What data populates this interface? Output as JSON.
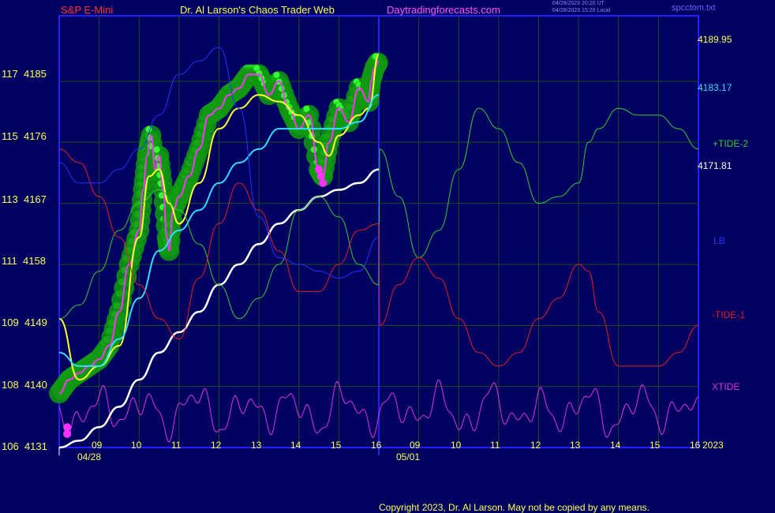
{
  "header": {
    "left_title": "S&P E-Mini",
    "center_title": "Dr. Al Larson's Chaos Trader Web",
    "site": "Daytradingforecasts.com",
    "timestamp_utc": "04/28/2023 20:20 UT",
    "timestamp_local": "04/28/2023 15:20 Local",
    "file": "spcctom.txt"
  },
  "footer": {
    "copyright": "Copyright 2023, Dr. Al Larson. May not be copied by any means."
  },
  "colors": {
    "background": "#000060",
    "frame": "#2020ff",
    "grid": "#1f4a1f",
    "price": "#ff33ff",
    "fast_ma": "#ffff33",
    "mid_ma": "#33ddff",
    "slow_ma": "#ffffff",
    "tide2": "#33cc33",
    "tide1": "#dd2222",
    "lb": "#2233ff",
    "xtide": "#dd33dd",
    "highlight": "#119911",
    "highlight_dot": "#33ff33",
    "low_dot": "#ff33ff"
  },
  "chart_data": {
    "type": "line",
    "title": "S&P E-Mini",
    "y_axis_labels": [
      {
        "left": "117",
        "right": "4185"
      },
      {
        "left": "115",
        "right": "4176"
      },
      {
        "left": "113",
        "right": "4167"
      },
      {
        "left": "111",
        "right": "4158"
      },
      {
        "left": "109",
        "right": "4149"
      },
      {
        "left": "108",
        "right": "4140"
      },
      {
        "left": "106",
        "right": "4131"
      }
    ],
    "ylim": [
      4131,
      4185
    ],
    "x_hour_labels": [
      "09",
      "10",
      "11",
      "12",
      "13",
      "14",
      "15",
      "16",
      "09",
      "10",
      "11",
      "12",
      "13",
      "14",
      "15",
      "16"
    ],
    "x_date_labels": [
      "04/28",
      "05/01"
    ],
    "x_end_label": "2023",
    "x_unit": "hours",
    "xlim": [
      8,
      24
    ],
    "now_x": 16,
    "right_labels": {
      "last_price": "4189.95",
      "mid_ma_value": "4183.17",
      "slow_ma_value": "4171.81",
      "tide2": "+TIDE-2",
      "lb": "LB",
      "tide1": "-TIDE-1",
      "xtide": "XTIDE"
    },
    "series": [
      {
        "name": "price",
        "x": [
          8,
          8.25,
          8.5,
          8.75,
          9,
          9.25,
          9.5,
          9.75,
          10,
          10.1,
          10.2,
          10.3,
          10.4,
          10.5,
          10.6,
          10.7,
          10.75,
          10.85,
          11,
          11.25,
          11.5,
          11.75,
          12,
          12.25,
          12.5,
          12.75,
          13,
          13.25,
          13.5,
          13.75,
          14,
          14.25,
          14.5,
          14.6,
          14.75,
          15,
          15.25,
          15.5,
          15.75,
          15.8,
          15.9,
          16
        ],
        "y": [
          4139,
          4141,
          4142,
          4143,
          4144,
          4146,
          4151,
          4158,
          4163,
          4169,
          4174,
          4177,
          4172,
          4174,
          4169,
          4162,
          4160,
          4166,
          4168,
          4171,
          4175,
          4180,
          4181,
          4183,
          4184,
          4186,
          4186,
          4183,
          4185,
          4181,
          4178,
          4180,
          4172,
          4171,
          4176,
          4181,
          4179,
          4184,
          4182,
          4185,
          4187,
          4188
        ]
      },
      {
        "name": "fast_ma",
        "x": [
          8,
          8.5,
          9,
          9.5,
          10,
          10.25,
          10.5,
          10.75,
          11,
          11.5,
          12,
          12.5,
          13,
          13.5,
          14,
          14.5,
          14.75,
          15,
          15.5,
          15.75,
          16
        ],
        "y": [
          4150,
          4141,
          4143,
          4146,
          4162,
          4171,
          4172,
          4167,
          4164,
          4170,
          4178,
          4181,
          4183,
          4182,
          4180,
          4176,
          4174,
          4177,
          4180,
          4181,
          4189
        ]
      },
      {
        "name": "mid_ma",
        "x": [
          8,
          8.5,
          9,
          9.5,
          10,
          10.5,
          11,
          11.5,
          12,
          12.5,
          13,
          13.5,
          14,
          14.5,
          15,
          15.5,
          16
        ],
        "y": [
          4145,
          4143,
          4143,
          4147,
          4153,
          4160,
          4163,
          4166,
          4170,
          4173,
          4175,
          4178,
          4178,
          4178,
          4178,
          4179,
          4183
        ]
      },
      {
        "name": "slow_ma",
        "x": [
          8,
          8.5,
          9,
          9.5,
          10,
          10.5,
          11,
          11.5,
          12,
          12.5,
          13,
          13.5,
          14,
          14.5,
          15,
          15.5,
          16
        ],
        "y": [
          4131,
          4132,
          4134,
          4137,
          4141,
          4145,
          4148,
          4151,
          4155,
          4158,
          4161,
          4164,
          4166,
          4168,
          4169,
          4170,
          4172
        ]
      },
      {
        "name": "+TIDE-2",
        "x": [
          8,
          8.5,
          9,
          9.5,
          10,
          10.5,
          11,
          11.5,
          12,
          12.5,
          13,
          13.5,
          14,
          14.5,
          15,
          15.5,
          16,
          16.02,
          16.5,
          17,
          17.5,
          18,
          18.5,
          19,
          19.5,
          20,
          20.5,
          21,
          21.25,
          21.5,
          22,
          22.5,
          23,
          23.5,
          24
        ],
        "y": [
          4150,
          4152,
          4157,
          4163,
          4167,
          4169,
          4166,
          4161,
          4155,
          4150,
          4153,
          4158,
          4166,
          4168,
          4165,
          4158,
          4155,
          4175,
          4168,
          4159,
          4163,
          4172,
          4181,
          4178,
          4173,
          4167,
          4168,
          4170,
          4176,
          4178,
          4181,
          4180,
          4180,
          4178,
          4175
        ]
      },
      {
        "name": "-TIDE-1",
        "x": [
          8,
          8.5,
          9,
          9.5,
          10,
          10.5,
          11,
          11.5,
          12,
          12.5,
          13,
          13.5,
          14,
          14.5,
          15,
          15.5,
          16,
          16.02,
          16.5,
          17,
          17.5,
          18,
          18.5,
          19,
          19.5,
          20,
          20.5,
          21,
          21.25,
          21.5,
          22,
          22.5,
          23,
          23.5,
          24
        ],
        "y": [
          4175,
          4173,
          4168,
          4162,
          4155,
          4150,
          4147,
          4156,
          4164,
          4170,
          4166,
          4160,
          4154,
          4154,
          4158,
          4163,
          4164,
          4149,
          4155,
          4159,
          4156,
          4150,
          4145,
          4143,
          4145,
          4150,
          4153,
          4158,
          4157,
          4151,
          4143,
          4143,
          4143,
          4145,
          4149
        ]
      },
      {
        "name": "LB",
        "x": [
          8,
          8.5,
          9,
          9.5,
          10,
          10.5,
          11,
          11.5,
          12,
          12.5,
          13,
          13.5,
          14,
          14.5,
          15,
          15.5,
          16
        ],
        "y": [
          4173,
          4170,
          4170,
          4172,
          4175,
          4180,
          4186,
          4188,
          4190,
          4181,
          4165,
          4159,
          4158,
          4157,
          4156,
          4157,
          4162
        ]
      }
    ]
  }
}
